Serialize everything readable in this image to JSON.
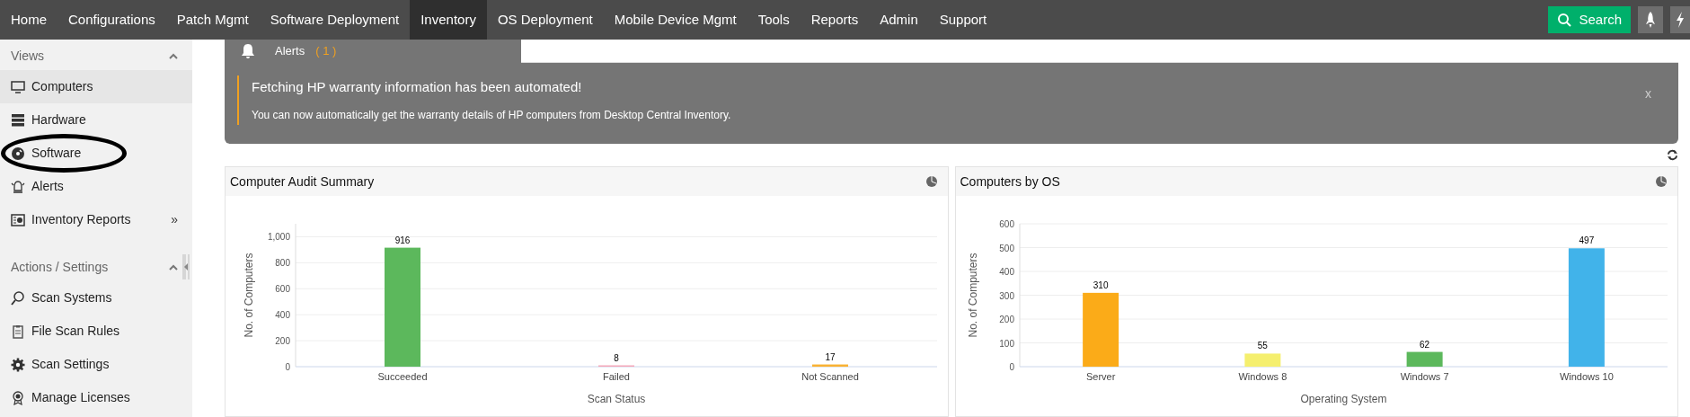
{
  "top_nav": {
    "items": [
      {
        "label": "Home",
        "selected": false
      },
      {
        "label": "Configurations",
        "selected": false
      },
      {
        "label": "Patch Mgmt",
        "selected": false
      },
      {
        "label": "Software Deployment",
        "selected": false
      },
      {
        "label": "Inventory",
        "selected": true
      },
      {
        "label": "OS Deployment",
        "selected": false
      },
      {
        "label": "Mobile Device Mgmt",
        "selected": false
      },
      {
        "label": "Tools",
        "selected": false
      },
      {
        "label": "Reports",
        "selected": false
      },
      {
        "label": "Admin",
        "selected": false
      },
      {
        "label": "Support",
        "selected": false
      }
    ],
    "search_button": "Search"
  },
  "sidebar": {
    "sections": [
      {
        "title": "Views",
        "expanded": true,
        "items": [
          {
            "label": "Computers",
            "selected": true
          },
          {
            "label": "Hardware",
            "selected": false
          },
          {
            "label": "Software",
            "selected": false,
            "circled": true
          },
          {
            "label": "Alerts",
            "selected": false
          },
          {
            "label": "Inventory Reports",
            "selected": false,
            "more": "»"
          }
        ]
      },
      {
        "title": "Actions / Settings",
        "expanded": true,
        "items": [
          {
            "label": "Scan Systems",
            "selected": false
          },
          {
            "label": "File Scan Rules",
            "selected": false
          },
          {
            "label": "Scan Settings",
            "selected": false
          },
          {
            "label": "Manage Licenses",
            "selected": false
          }
        ]
      }
    ]
  },
  "alerts": {
    "tab_label": "Alerts",
    "count": "( 1 )",
    "title": "Fetching HP warranty information has been automated!",
    "message": "You can now automatically get the warranty details of HP computers from Desktop Central Inventory.",
    "close": "x"
  },
  "charts": [
    {
      "title": "Computer Audit Summary",
      "chart_data": {
        "type": "bar",
        "xlabel": "Scan Status",
        "ylabel": "No. of Computers",
        "series": [
          {
            "name": "Succeeded",
            "color": "#5cb85c",
            "values": [
              916
            ]
          },
          {
            "name": "Failed",
            "color": "#f4a7b9",
            "values": [
              8
            ]
          },
          {
            "name": "Not Scanned",
            "color": "#f9b233",
            "values": [
              17
            ]
          }
        ],
        "grid": true,
        "ylim": [
          0,
          1100
        ],
        "yticks": [
          0,
          200,
          400,
          600,
          800,
          {
            "value": 1000,
            "label": "1,000"
          }
        ],
        "data_labels": true
      }
    },
    {
      "title": "Computers by OS",
      "chart_data": {
        "type": "bar",
        "xlabel": "Operating System",
        "ylabel": "No. of Computers",
        "series": [
          {
            "name": "Server",
            "color": "#fbab18",
            "values": [
              310
            ]
          },
          {
            "name": "Windows 8",
            "color": "#f5ef6e",
            "values": [
              55
            ]
          },
          {
            "name": "Windows 7",
            "color": "#5cb85c",
            "values": [
              62
            ]
          },
          {
            "name": "Windows 10",
            "color": "#41b3ea",
            "values": [
              497
            ]
          }
        ],
        "grid": true,
        "ylim": [
          0,
          600
        ],
        "yticks": [
          0,
          100,
          200,
          300,
          400,
          500,
          600
        ],
        "data_labels": true
      }
    }
  ]
}
